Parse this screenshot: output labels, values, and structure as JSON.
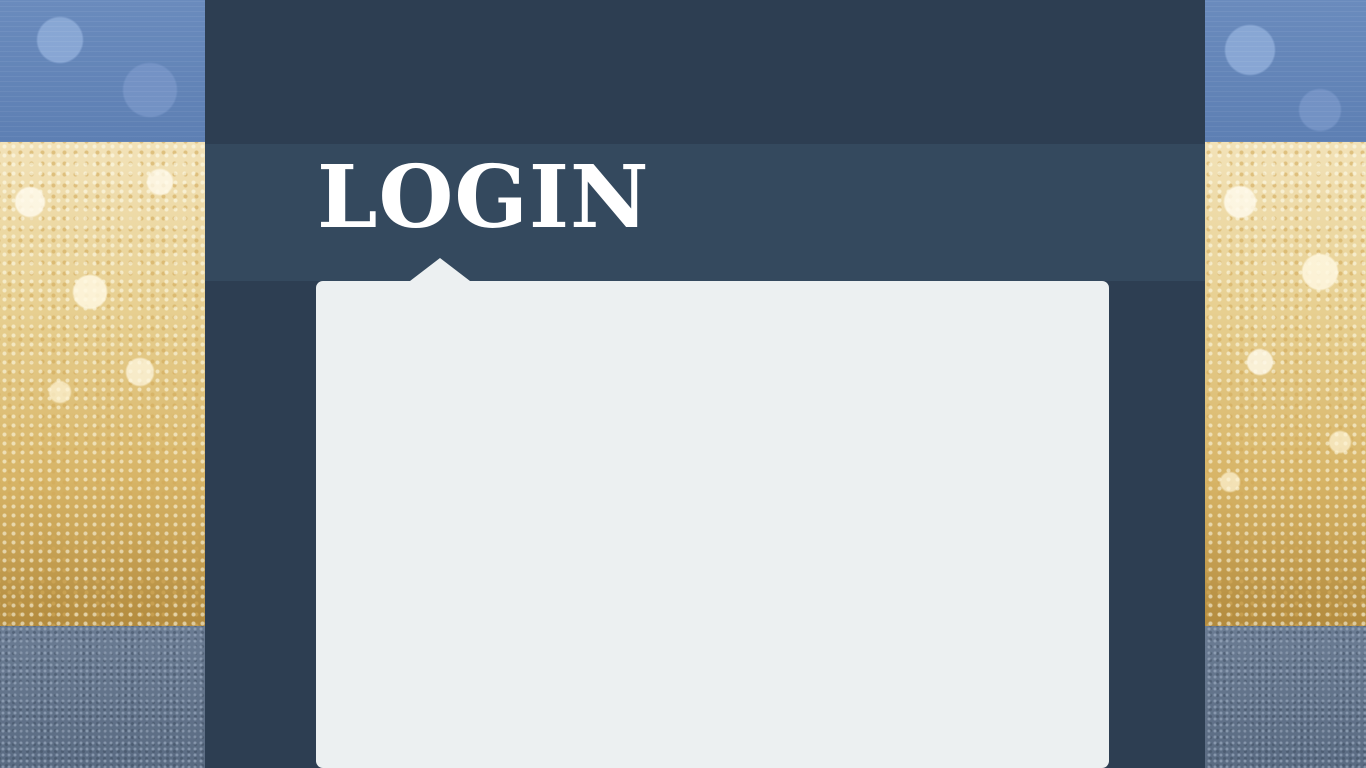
{
  "login": {
    "title": "LOGIN"
  },
  "colors": {
    "column_background": "#2d3e52",
    "title_band": "#34495e",
    "panel_background": "#ecf0f1",
    "title_text": "#ffffff"
  }
}
